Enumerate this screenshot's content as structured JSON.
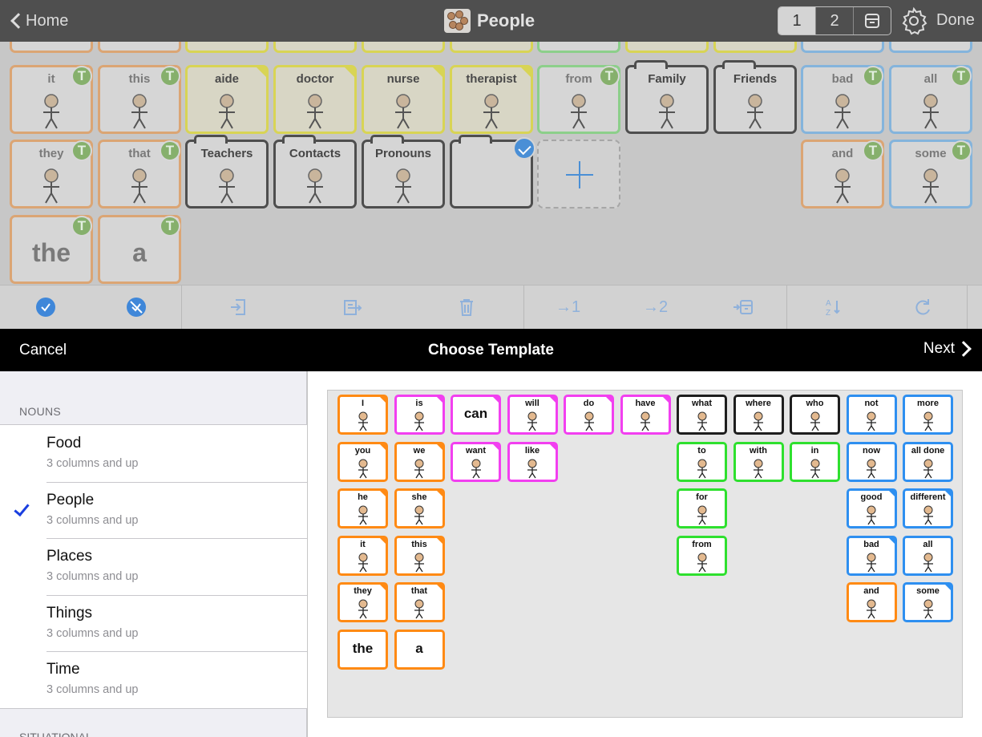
{
  "topbar": {
    "back_label": "Home",
    "title": "People",
    "title_icon": "people-faces-icon",
    "page_tabs": [
      "1",
      "2"
    ],
    "archive_icon": "archive-box-icon",
    "settings_icon": "gear-icon",
    "done_label": "Done"
  },
  "board": {
    "partial_row": [
      {
        "color": "orange"
      },
      {
        "color": "orange"
      },
      {
        "color": "yellow"
      },
      {
        "color": "yellow"
      },
      {
        "color": "yellow"
      },
      {
        "color": "yellow"
      },
      {
        "color": "green"
      },
      {
        "color": "yellow"
      },
      {
        "color": "yellow"
      },
      {
        "color": "blue"
      },
      {
        "color": "blue"
      }
    ],
    "row1": [
      {
        "label": "it",
        "type": "word",
        "color": "orange",
        "badge": "T"
      },
      {
        "label": "this",
        "type": "word",
        "color": "orange",
        "badge": "T"
      },
      {
        "label": "aide",
        "type": "word",
        "color": "yellow"
      },
      {
        "label": "doctor",
        "type": "word",
        "color": "yellow"
      },
      {
        "label": "nurse",
        "type": "word",
        "color": "yellow"
      },
      {
        "label": "therapist",
        "type": "word",
        "color": "yellow"
      },
      {
        "label": "from",
        "type": "word",
        "color": "green",
        "badge": "T"
      },
      {
        "label": "Family",
        "type": "folder"
      },
      {
        "label": "Friends",
        "type": "folder"
      },
      {
        "label": "bad",
        "type": "word",
        "color": "blue",
        "badge": "T"
      },
      {
        "label": "all",
        "type": "word",
        "color": "blue",
        "badge": "T"
      }
    ],
    "row2": [
      {
        "label": "they",
        "type": "word",
        "color": "orange",
        "badge": "T"
      },
      {
        "label": "that",
        "type": "word",
        "color": "orange",
        "badge": "T"
      },
      {
        "label": "Teachers",
        "type": "folder"
      },
      {
        "label": "Contacts",
        "type": "folder"
      },
      {
        "label": "Pronouns",
        "type": "folder"
      },
      {
        "label": "",
        "type": "folder",
        "selected": true
      },
      {
        "label": "",
        "type": "add"
      },
      {
        "label": "and",
        "type": "word",
        "color": "orange",
        "badge": "T"
      },
      {
        "label": "some",
        "type": "word",
        "color": "blue",
        "badge": "T"
      }
    ],
    "row3": [
      {
        "label": "the",
        "type": "word",
        "color": "orange",
        "badge": "T"
      },
      {
        "label": "a",
        "type": "word",
        "color": "orange",
        "badge": "T"
      }
    ]
  },
  "toolbar": {
    "buttons": [
      {
        "name": "select-all",
        "icon": "check-circle-icon"
      },
      {
        "name": "deselect-all",
        "icon": "uncheck-circle-icon"
      },
      {
        "name": "import",
        "icon": "import-icon"
      },
      {
        "name": "export",
        "icon": "export-clipboard-icon"
      },
      {
        "name": "delete",
        "icon": "trash-icon"
      },
      {
        "name": "move-to-page-1",
        "label": "→1"
      },
      {
        "name": "move-to-page-2",
        "label": "→2"
      },
      {
        "name": "move-to-archive",
        "icon": "move-archive-icon"
      },
      {
        "name": "sort",
        "icon": "sort-az-icon"
      },
      {
        "name": "refresh",
        "icon": "refresh-icon"
      },
      {
        "name": "swap",
        "icon": "swap-arrows-icon"
      }
    ]
  },
  "modal": {
    "cancel_label": "Cancel",
    "title": "Choose Template",
    "next_label": "Next"
  },
  "templates": {
    "section": "NOUNS",
    "items": [
      {
        "name": "Food",
        "sub": "3 columns and up",
        "selected": false
      },
      {
        "name": "People",
        "sub": "3 columns and up",
        "selected": true
      },
      {
        "name": "Places",
        "sub": "3 columns and up",
        "selected": false
      },
      {
        "name": "Things",
        "sub": "3 columns and up",
        "selected": false
      },
      {
        "name": "Time",
        "sub": "3 columns and up",
        "selected": false
      }
    ],
    "next_section": "SITUATIONAL"
  },
  "preview": {
    "cells": [
      {
        "label": "I",
        "color": "orange",
        "col": 0,
        "row": 0,
        "fold": true
      },
      {
        "label": "is",
        "color": "magenta",
        "col": 1,
        "row": 0,
        "fold": true
      },
      {
        "label": "can",
        "color": "magenta",
        "col": 2,
        "row": 0,
        "fold": true,
        "big": true
      },
      {
        "label": "will",
        "color": "magenta",
        "col": 3,
        "row": 0,
        "fold": true
      },
      {
        "label": "do",
        "color": "magenta",
        "col": 4,
        "row": 0,
        "fold": true
      },
      {
        "label": "have",
        "color": "magenta",
        "col": 5,
        "row": 0,
        "fold": true
      },
      {
        "label": "what",
        "color": "black",
        "col": 6,
        "row": 0
      },
      {
        "label": "where",
        "color": "black",
        "col": 7,
        "row": 0
      },
      {
        "label": "who",
        "color": "black",
        "col": 8,
        "row": 0
      },
      {
        "label": "not",
        "color": "blue",
        "col": 9,
        "row": 0
      },
      {
        "label": "more",
        "color": "blue",
        "col": 10,
        "row": 0
      },
      {
        "label": "you",
        "color": "orange",
        "col": 0,
        "row": 1,
        "fold": true
      },
      {
        "label": "we",
        "color": "orange",
        "col": 1,
        "row": 1,
        "fold": true
      },
      {
        "label": "want",
        "color": "magenta",
        "col": 2,
        "row": 1,
        "fold": true
      },
      {
        "label": "like",
        "color": "magenta",
        "col": 3,
        "row": 1,
        "fold": true
      },
      {
        "label": "to",
        "color": "green",
        "col": 6,
        "row": 1
      },
      {
        "label": "with",
        "color": "green",
        "col": 7,
        "row": 1
      },
      {
        "label": "in",
        "color": "green",
        "col": 8,
        "row": 1
      },
      {
        "label": "now",
        "color": "blue",
        "col": 9,
        "row": 1
      },
      {
        "label": "all done",
        "color": "blue",
        "col": 10,
        "row": 1
      },
      {
        "label": "he",
        "color": "orange",
        "col": 0,
        "row": 2,
        "fold": true
      },
      {
        "label": "she",
        "color": "orange",
        "col": 1,
        "row": 2,
        "fold": true
      },
      {
        "label": "for",
        "color": "green",
        "col": 6,
        "row": 2
      },
      {
        "label": "good",
        "color": "blue",
        "col": 9,
        "row": 2,
        "fold": true
      },
      {
        "label": "different",
        "color": "blue",
        "col": 10,
        "row": 2,
        "fold": true
      },
      {
        "label": "it",
        "color": "orange",
        "col": 0,
        "row": 3,
        "fold": true
      },
      {
        "label": "this",
        "color": "orange",
        "col": 1,
        "row": 3,
        "fold": true
      },
      {
        "label": "from",
        "color": "green",
        "col": 6,
        "row": 3
      },
      {
        "label": "bad",
        "color": "blue",
        "col": 9,
        "row": 3,
        "fold": true
      },
      {
        "label": "all",
        "color": "blue",
        "col": 10,
        "row": 3
      },
      {
        "label": "they",
        "color": "orange",
        "col": 0,
        "row": 4,
        "fold": true
      },
      {
        "label": "that",
        "color": "orange",
        "col": 1,
        "row": 4,
        "fold": true
      },
      {
        "label": "and",
        "color": "orange",
        "col": 9,
        "row": 4
      },
      {
        "label": "some",
        "color": "blue",
        "col": 10,
        "row": 4,
        "fold": true
      },
      {
        "label": "the",
        "color": "orange",
        "col": 0,
        "row": 5,
        "big": true
      },
      {
        "label": "a",
        "color": "orange",
        "col": 1,
        "row": 5,
        "big": true
      }
    ]
  }
}
